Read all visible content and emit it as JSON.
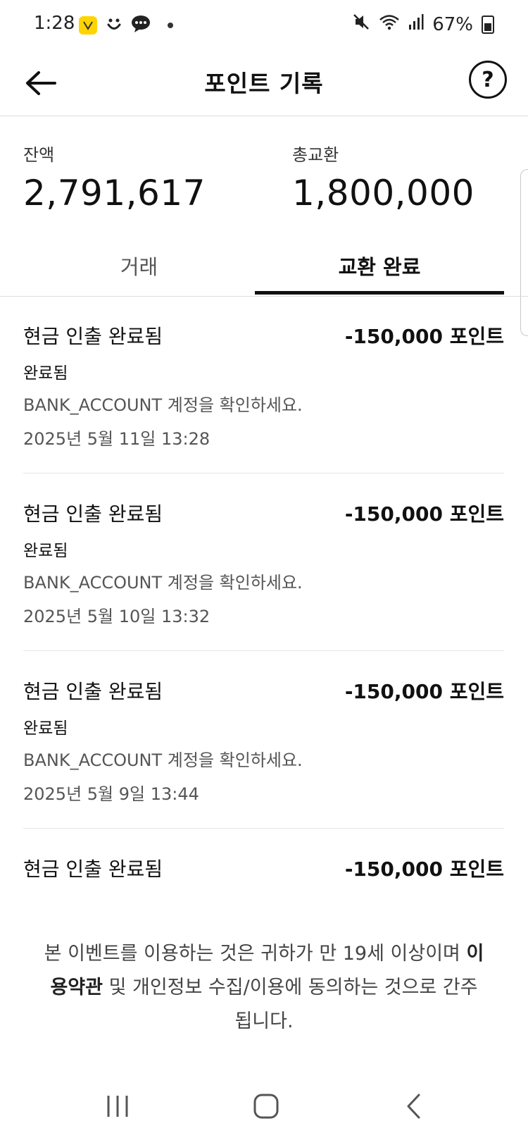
{
  "status_bar": {
    "time": "1:28",
    "battery": "67%"
  },
  "header": {
    "title": "포인트 기록"
  },
  "summary": {
    "balance_label": "잔액",
    "balance_value": "2,791,617",
    "total_label": "총교환",
    "total_value": "1,800,000"
  },
  "tabs": [
    {
      "label": "거래",
      "active": false
    },
    {
      "label": "교환 완료",
      "active": true
    }
  ],
  "records": [
    {
      "title": "현금 인출 완료됨",
      "amount": "-150,000 포인트",
      "status": "완료됨",
      "description": "BANK_ACCOUNT 계정을 확인하세요.",
      "date": "2025년 5월 11일 13:28"
    },
    {
      "title": "현금 인출 완료됨",
      "amount": "-150,000 포인트",
      "status": "완료됨",
      "description": "BANK_ACCOUNT 계정을 확인하세요.",
      "date": "2025년 5월 10일 13:32"
    },
    {
      "title": "현금 인출 완료됨",
      "amount": "-150,000 포인트",
      "status": "완료됨",
      "description": "BANK_ACCOUNT 계정을 확인하세요.",
      "date": "2025년 5월 9일 13:44"
    },
    {
      "title": "현금 인출 완료됨",
      "amount": "-150,000 포인트",
      "status": "",
      "description": "",
      "date": ""
    }
  ],
  "footer": {
    "text_before": "본 이벤트를 이용하는 것은 귀하가 만 19세 이상이며 ",
    "terms_link": "이용약관",
    "text_after": " 및 개인정보 수집/이용에 동의하는 것으로 간주됩니다."
  },
  "colors": {
    "accent": "#111111",
    "badge": "#ffd400"
  }
}
